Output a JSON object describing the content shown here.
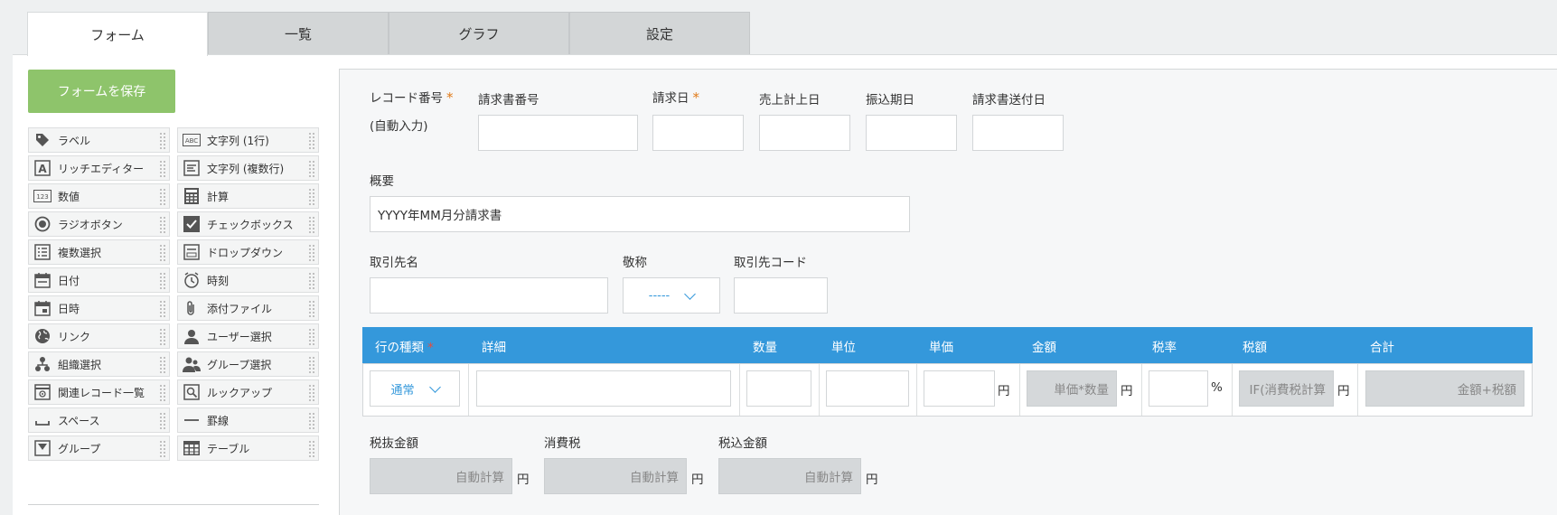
{
  "tabs": [
    {
      "label": "フォーム",
      "active": true
    },
    {
      "label": "一覧",
      "active": false
    },
    {
      "label": "グラフ",
      "active": false
    },
    {
      "label": "設定",
      "active": false
    }
  ],
  "save_button": "フォームを保存",
  "palette": [
    {
      "label": "ラベル",
      "icon": "tag-icon"
    },
    {
      "label": "文字列 (1行)",
      "icon": "abc-icon"
    },
    {
      "label": "リッチエディター",
      "icon": "rich-text-icon"
    },
    {
      "label": "文字列 (複数行)",
      "icon": "multiline-text-icon"
    },
    {
      "label": "数値",
      "icon": "number-icon"
    },
    {
      "label": "計算",
      "icon": "calculator-icon"
    },
    {
      "label": "ラジオボタン",
      "icon": "radio-icon"
    },
    {
      "label": "チェックボックス",
      "icon": "checkbox-icon"
    },
    {
      "label": "複数選択",
      "icon": "multi-select-icon"
    },
    {
      "label": "ドロップダウン",
      "icon": "dropdown-icon"
    },
    {
      "label": "日付",
      "icon": "calendar-icon"
    },
    {
      "label": "時刻",
      "icon": "clock-icon"
    },
    {
      "label": "日時",
      "icon": "datetime-icon"
    },
    {
      "label": "添付ファイル",
      "icon": "paperclip-icon"
    },
    {
      "label": "リンク",
      "icon": "globe-icon"
    },
    {
      "label": "ユーザー選択",
      "icon": "user-icon"
    },
    {
      "label": "組織選択",
      "icon": "org-icon"
    },
    {
      "label": "グループ選択",
      "icon": "group-icon"
    },
    {
      "label": "関連レコード一覧",
      "icon": "related-records-icon"
    },
    {
      "label": "ルックアップ",
      "icon": "lookup-icon"
    },
    {
      "label": "スペース",
      "icon": "space-icon"
    },
    {
      "label": "罫線",
      "icon": "line-icon"
    },
    {
      "label": "グループ",
      "icon": "group-folder-icon"
    },
    {
      "label": "テーブル",
      "icon": "table-icon"
    }
  ],
  "form": {
    "record_number_label": "レコード番号",
    "record_number_value": "(自動入力)",
    "invoice_number_label": "請求書番号",
    "invoice_date_label": "請求日",
    "sales_date_label": "売上計上日",
    "transfer_date_label": "振込期日",
    "send_date_label": "請求書送付日",
    "summary_label": "概要",
    "summary_value": "YYYY年MM月分請求書",
    "client_label": "取引先名",
    "honorific_label": "敬称",
    "honorific_value": "-----",
    "client_code_label": "取引先コード",
    "required_mark": "*",
    "table": {
      "headers": [
        "行の種類",
        "詳細",
        "数量",
        "単位",
        "単価",
        "金額",
        "税率",
        "税額",
        "合計"
      ],
      "row_type_value": "通常",
      "unit_price_suffix": "円",
      "amount_formula": "単価*数量",
      "amount_suffix": "円",
      "tax_rate_suffix": "%",
      "tax_formula": "IF(消費税計算",
      "tax_suffix": "円",
      "total_formula": "金額+税額"
    },
    "subtotal_label": "税抜金額",
    "tax_label": "消費税",
    "total_label": "税込金額",
    "auto_calc": "自動計算",
    "yen": "円"
  }
}
